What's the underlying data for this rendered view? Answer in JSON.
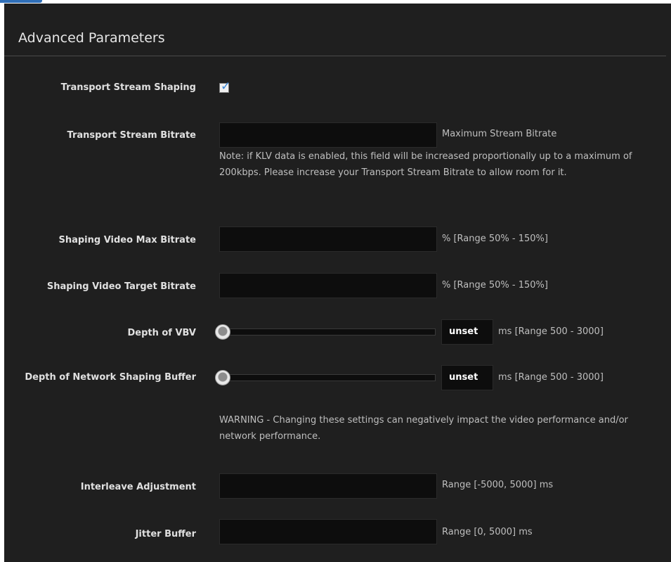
{
  "panel": {
    "title": "Advanced Parameters"
  },
  "fields": {
    "ts_shaping": {
      "label": "Transport Stream Shaping",
      "checked": true
    },
    "ts_bitrate": {
      "label": "Transport Stream Bitrate",
      "value": "",
      "hint": "Maximum Stream Bitrate",
      "note": "Note: if KLV data is enabled, this field will be increased proportionally up to a maximum of 200kbps. Please increase your Transport Stream Bitrate to allow room for it."
    },
    "shaping_video_max": {
      "label": "Shaping Video Max Bitrate",
      "value": "",
      "hint": "% [Range 50% - 150%]"
    },
    "shaping_video_target": {
      "label": "Shaping Video Target Bitrate",
      "value": "",
      "hint": "% [Range 50% - 150%]"
    },
    "depth_vbv": {
      "label": "Depth of VBV",
      "value": "unset",
      "hint": "ms [Range 500 - 3000]",
      "slider_fraction": 0
    },
    "depth_network": {
      "label": "Depth of Network Shaping Buffer",
      "value": "unset",
      "hint": "ms [Range 500 - 3000]",
      "slider_fraction": 0,
      "warning": "WARNING - Changing these settings can negatively impact the video performance and/or network performance."
    },
    "interleave": {
      "label": "Interleave Adjustment",
      "value": "",
      "hint": "Range [-5000, 5000] ms"
    },
    "jitter": {
      "label": "Jitter Buffer",
      "value": "",
      "hint": "Range [0, 5000] ms"
    }
  },
  "colors": {
    "panel_bg": "#1f1f1f",
    "field_bg": "#0d0d0d",
    "accent_blue": "#3a86d6"
  }
}
